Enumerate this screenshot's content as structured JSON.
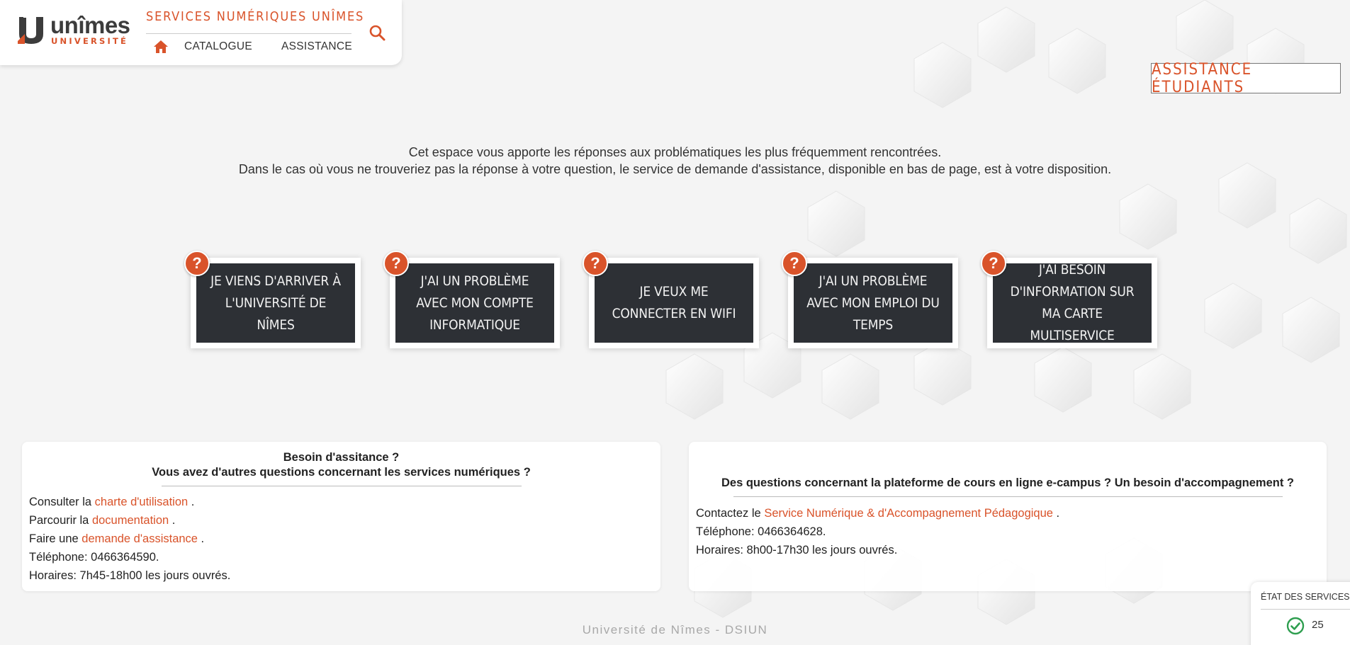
{
  "header": {
    "logo_word": "unîmes",
    "logo_sub": "UNIVERSITÉ",
    "site_title": "SERVICES NUMÉRIQUES UNÎMES",
    "nav": {
      "catalogue": "CATALOGUE",
      "assistance": "ASSISTANCE"
    }
  },
  "page_badge": "ASSISTANCE ÉTUDIANTS",
  "intro": {
    "line1": "Cet espace vous apporte les réponses aux problématiques les plus fréquemment rencontrées.",
    "line2": "Dans le cas où vous ne trouveriez pas la réponse à votre question, le service de demande d'assistance, disponible en bas de page, est à votre disposition."
  },
  "cards": [
    {
      "label": "JE VIENS D'ARRIVER À L'UNIVERSITÉ DE NÎMES",
      "badge": "?"
    },
    {
      "label": "J'AI UN PROBLÈME AVEC MON COMPTE INFORMATIQUE",
      "badge": "?"
    },
    {
      "label": "JE VEUX ME CONNECTER EN WIFI",
      "badge": "?"
    },
    {
      "label": "J'AI UN PROBLÈME AVEC MON EMPLOI DU TEMPS",
      "badge": "?"
    },
    {
      "label": "J'AI BESOIN D'INFORMATION SUR MA CARTE MULTISERVICE",
      "badge": "?"
    }
  ],
  "left_panel": {
    "title1": "Besoin d'assitance ?",
    "title2": "Vous avez d'autres questions concernant les services numériques ?",
    "l1_pre": "Consulter la ",
    "l1_link": "charte d'utilisation",
    "l1_post": " .",
    "l2_pre": "Parcourir la ",
    "l2_link": "documentation",
    "l2_post": " .",
    "l3_pre": "Faire une ",
    "l3_link": "demande d'assistance",
    "l3_post": " .",
    "phone": "Téléphone: 0466364590.",
    "hours": "Horaires: 7h45-18h00 les jours ouvrés."
  },
  "right_panel": {
    "title": "Des questions concernant la plateforme de cours en ligne e-campus ? Un besoin d'accompagnement ?",
    "l1_pre": "Contactez le ",
    "l1_link": "Service Numérique & d'Accompagnement Pédagogique",
    "l1_post": "  .",
    "phone": "Téléphone: 0466364628.",
    "hours": "Horaires: 8h00-17h30 les jours ouvrés."
  },
  "footer": "Université de Nîmes - DSIUN",
  "status_widget": {
    "label": "ÉTAT DES SERVICES",
    "count": "25"
  },
  "colors": {
    "accent": "#d9532a",
    "card_bg": "#2d3035"
  }
}
